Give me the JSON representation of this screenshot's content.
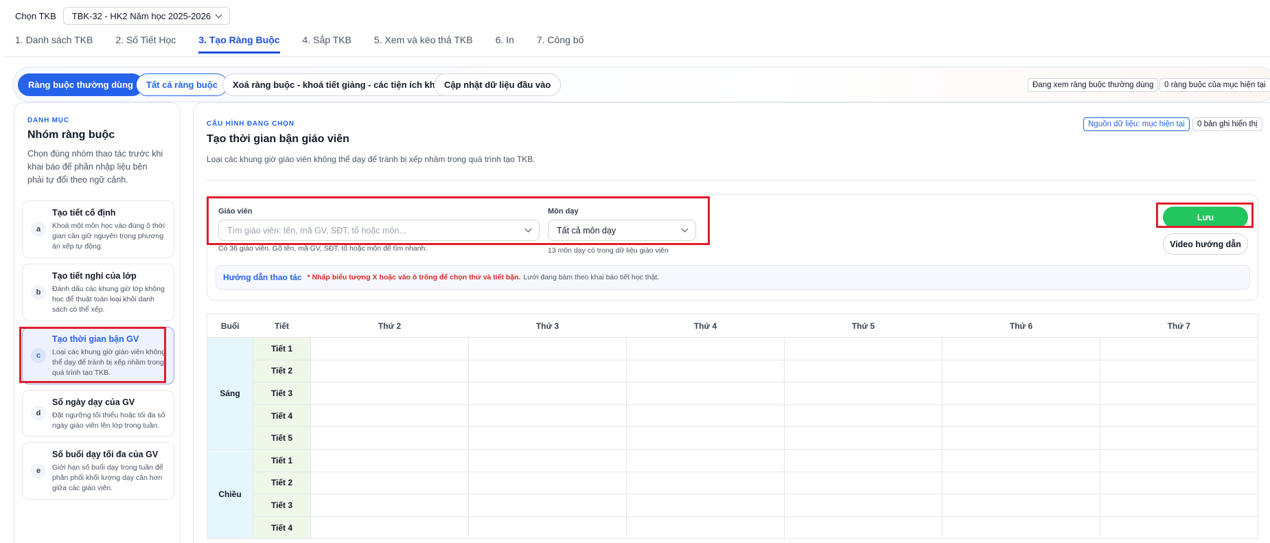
{
  "top": {
    "select_label": "Chọn TKB",
    "select_value": "TBK-32 - HK2 Năm học 2025-2026"
  },
  "steps": [
    {
      "label": "1. Danh sách TKB"
    },
    {
      "label": "2. Số Tiết Học"
    },
    {
      "label": "3. Tạo Ràng Buộc"
    },
    {
      "label": "4. Sắp TKB"
    },
    {
      "label": "5. Xem và kéo thả TKB"
    },
    {
      "label": "6. In"
    },
    {
      "label": "7. Công bố"
    }
  ],
  "active_step": "3. Tạo Ràng Buộc",
  "filter": {
    "common": "Ràng buộc thường dùng",
    "all": "Tất cả ràng buộc",
    "delete": "Xoá ràng buộc - khoá tiết giảng - các tiện ích khác",
    "update": "Cập nhật dữ liệu đầu vào",
    "viewing": "Đang xem ràng buộc thường dùng",
    "count": "0 ràng buộc của mục hiện tại"
  },
  "sidebar": {
    "kicker": "DANH MỤC",
    "title": "Nhóm ràng buộc",
    "desc": "Chọn đúng nhóm thao tác trước khi khai báo để phần nhập liệu bên phải tự đổi theo ngữ cảnh.",
    "items": [
      {
        "letter": "a",
        "title": "Tạo tiết cố định",
        "desc": "Khoá một môn học vào đúng ô thời gian cần giữ nguyên trong phương án xếp tự động."
      },
      {
        "letter": "b",
        "title": "Tạo tiết nghỉ của lớp",
        "desc": "Đánh dấu các khung giờ lớp không học để thuật toán loại khỏi danh sách có thể xếp."
      },
      {
        "letter": "c",
        "title": "Tạo thời gian bận GV",
        "desc": "Loại các khung giờ giáo viên không thể dạy để tránh bị xếp nhầm trong quá trình tạo TKB."
      },
      {
        "letter": "d",
        "title": "Số ngày dạy của GV",
        "desc": "Đặt ngưỡng tối thiểu hoặc tối đa số ngày giáo viên lên lớp trong tuần."
      },
      {
        "letter": "e",
        "title": "Số buổi dạy tối đa của GV",
        "desc": "Giới hạn số buổi dạy trong tuần để phân phối khối lượng dạy cân hơn giữa các giáo viên."
      }
    ]
  },
  "main": {
    "kicker": "CẤU HÌNH ĐANG CHỌN",
    "title": "Tạo thời gian bận giáo viên",
    "desc": "Loại các khung giờ giáo viên không thể dạy để tránh bị xếp nhầm trong quá trình tạo TKB.",
    "source_pill": "Nguồn dữ liệu: mục hiện tại",
    "records_pill": "0 bản ghi hiển thị",
    "teacher_label": "Giáo viên",
    "teacher_placeholder": "Tìm giáo viên: tên, mã GV, SĐT, tổ hoặc môn...",
    "teacher_hint": "Có 36 giáo viên. Gõ tên, mã GV, SĐT, tổ hoặc môn để tìm nhanh.",
    "subject_label": "Môn dạy",
    "subject_value": "Tất cả môn dạy",
    "subject_hint": "13 môn dạy có trong dữ liệu giáo viên",
    "save": "Lưu",
    "video": "Video hướng dẫn",
    "guide_title": "Hướng dẫn thao tác",
    "guide_warn": "* Nhấp biểu tượng X hoặc vào ô trống để chọn thứ và tiết bận.",
    "guide_note": "Lưới đang bám theo khai báo tiết học thật."
  },
  "grid": {
    "head_session": "Buổi",
    "head_period": "Tiết",
    "days": [
      "Thứ 2",
      "Thứ 3",
      "Thứ 4",
      "Thứ 5",
      "Thứ 6",
      "Thứ 7"
    ],
    "sessions": [
      {
        "name": "Sáng",
        "periods": [
          "Tiết 1",
          "Tiết 2",
          "Tiết 3",
          "Tiết 4",
          "Tiết 5"
        ]
      },
      {
        "name": "Chiều",
        "periods": [
          "Tiết 1",
          "Tiết 2",
          "Tiết 3",
          "Tiết 4"
        ]
      }
    ]
  }
}
